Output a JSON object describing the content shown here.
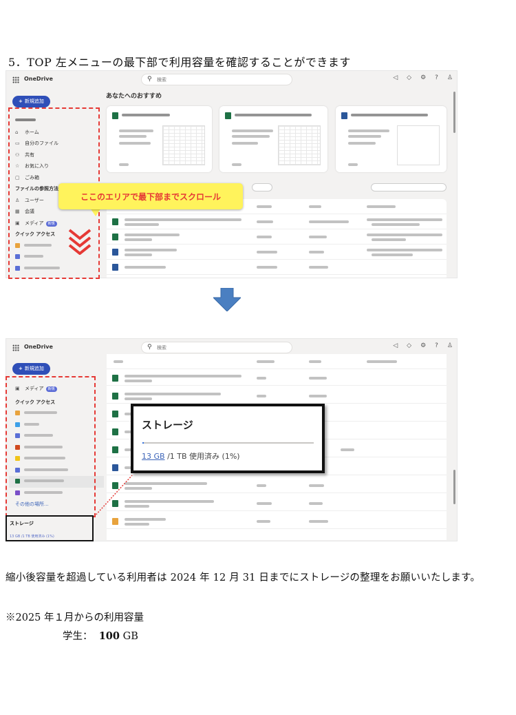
{
  "doc": {
    "step_heading": "5．TOP 左メニューの最下部で利用容量を確認することができます",
    "callout": "ここのエリアで最下部までスクロール",
    "paragraph": "縮小後容量を超過している利用者は 2024 年 12 月 31 日までにストレージの整理をお願いいたします。",
    "note_heading": "※2025 年１月からの利用容量",
    "quota_label": "学生：",
    "quota_value": "100",
    "quota_unit": "GB"
  },
  "app": {
    "name": "OneDrive",
    "search_placeholder": "検索",
    "new_button": "新規追加"
  },
  "shot1": {
    "recommended_title": "あなたへのおすすめ",
    "sidebar": {
      "items": [
        "ホーム",
        "自分のファイル",
        "共有",
        "お気に入り",
        "ごみ箱"
      ],
      "browse_heading": "ファイルの参照方法",
      "browse_items": [
        "ユーザー",
        "会議",
        "メディア"
      ],
      "media_badge": "新規",
      "quick_heading": "クイック アクセス"
    }
  },
  "shot2": {
    "sidebar": {
      "media": "メディア",
      "media_badge": "新規",
      "quick_heading": "クイック アクセス",
      "more_link": "その他の場所..."
    },
    "storage_small": {
      "title": "ストレージ",
      "usage": "13 GB /1 TB 使用済み (1%)"
    },
    "storage_popup": {
      "title": "ストレージ",
      "used_link": "13 GB",
      "used_rest": " /1 TB 使用済み (1%)",
      "percent": 1
    }
  },
  "icons": {
    "home": "⌂",
    "folder": "▭",
    "share": "⚇",
    "star": "☆",
    "trash": "🗑",
    "user": "♙",
    "meeting": "▦",
    "media": "▣",
    "search": "⚲"
  }
}
